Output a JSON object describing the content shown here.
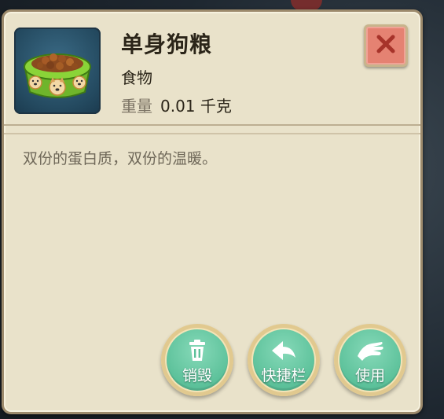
{
  "item": {
    "title": "单身狗粮",
    "type": "食物",
    "weight_label": "重量",
    "weight_value": "0.01 千克",
    "description": "双份的蛋白质，双份的温暖。",
    "icon": "dog-food-bowl-icon"
  },
  "close": {
    "icon": "close-icon"
  },
  "actions": [
    {
      "label": "销毁",
      "icon": "trash-icon"
    },
    {
      "label": "快捷栏",
      "icon": "arrow-back-icon"
    },
    {
      "label": "使用",
      "icon": "hand-icon"
    }
  ],
  "colors": {
    "panel": "#e9e2ca",
    "panel_border": "#9c8a6c",
    "close_button": "#e58272",
    "close_x": "#a7332a",
    "action_green": "#5cc19a",
    "action_ring": "#f3e4b8",
    "bowl_green": "#7bc62e"
  }
}
